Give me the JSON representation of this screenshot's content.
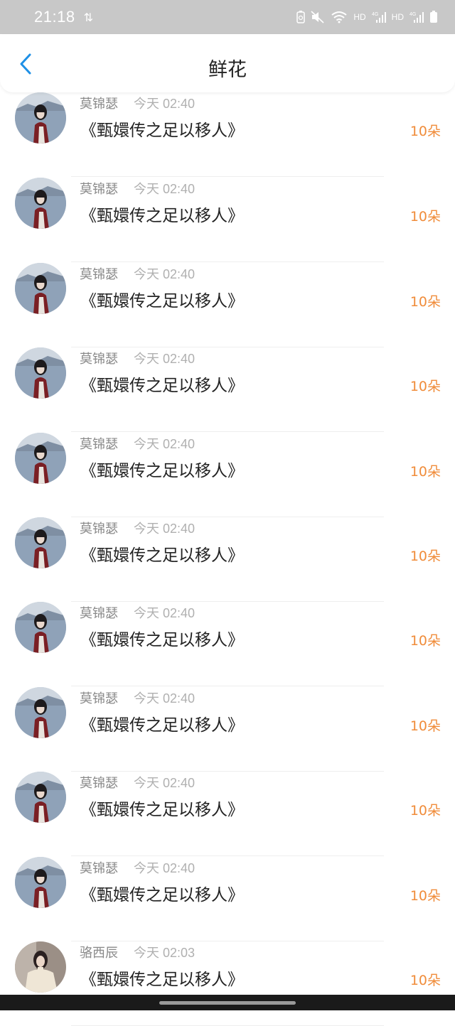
{
  "status_bar": {
    "time": "21:18",
    "icons": [
      "data-transfer-icon",
      "battery-saver-icon",
      "mute-icon",
      "wifi-icon",
      "hd-icon",
      "signal-4g-icon",
      "hd-icon",
      "signal-4g-icon",
      "battery-icon"
    ],
    "hd_label": "HD",
    "network_label": "4G"
  },
  "header": {
    "back_icon": "chevron-left-icon",
    "title": "鲜花"
  },
  "colors": {
    "accent": "#1e90e6",
    "count": "#f08c3a",
    "status_bar_bg": "#c8c8c8"
  },
  "items": [
    {
      "name": "莫锦瑟",
      "time": "今天 02:40",
      "book": "《甄嬛传之足以移人》",
      "count": "10朵",
      "avatar": "woman-seaside-avatar"
    },
    {
      "name": "莫锦瑟",
      "time": "今天 02:40",
      "book": "《甄嬛传之足以移人》",
      "count": "10朵",
      "avatar": "woman-seaside-avatar"
    },
    {
      "name": "莫锦瑟",
      "time": "今天 02:40",
      "book": "《甄嬛传之足以移人》",
      "count": "10朵",
      "avatar": "woman-seaside-avatar"
    },
    {
      "name": "莫锦瑟",
      "time": "今天 02:40",
      "book": "《甄嬛传之足以移人》",
      "count": "10朵",
      "avatar": "woman-seaside-avatar"
    },
    {
      "name": "莫锦瑟",
      "time": "今天 02:40",
      "book": "《甄嬛传之足以移人》",
      "count": "10朵",
      "avatar": "woman-seaside-avatar"
    },
    {
      "name": "莫锦瑟",
      "time": "今天 02:40",
      "book": "《甄嬛传之足以移人》",
      "count": "10朵",
      "avatar": "woman-seaside-avatar"
    },
    {
      "name": "莫锦瑟",
      "time": "今天 02:40",
      "book": "《甄嬛传之足以移人》",
      "count": "10朵",
      "avatar": "woman-seaside-avatar"
    },
    {
      "name": "莫锦瑟",
      "time": "今天 02:40",
      "book": "《甄嬛传之足以移人》",
      "count": "10朵",
      "avatar": "woman-seaside-avatar"
    },
    {
      "name": "莫锦瑟",
      "time": "今天 02:40",
      "book": "《甄嬛传之足以移人》",
      "count": "10朵",
      "avatar": "woman-seaside-avatar"
    },
    {
      "name": "莫锦瑟",
      "time": "今天 02:40",
      "book": "《甄嬛传之足以移人》",
      "count": "10朵",
      "avatar": "woman-seaside-avatar"
    },
    {
      "name": "骆西辰",
      "time": "今天 02:03",
      "book": "《甄嬛传之足以移人》",
      "count": "10朵",
      "avatar": "woman-cream-blouse-avatar"
    }
  ]
}
